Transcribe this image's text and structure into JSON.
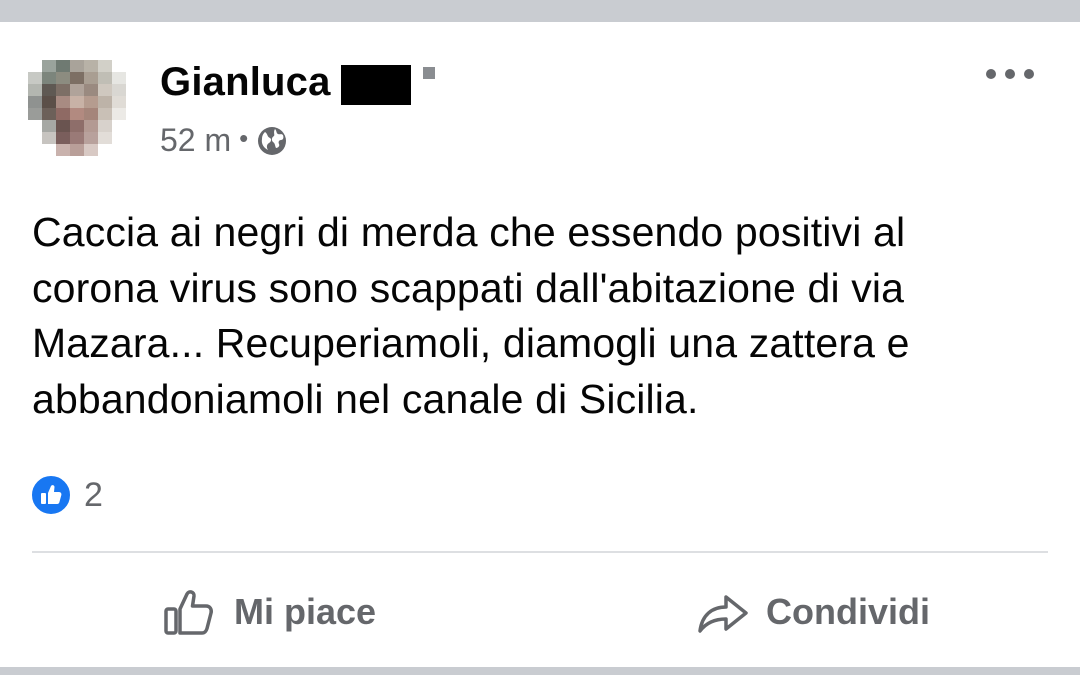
{
  "post": {
    "author_name": "Gianluca",
    "timestamp": "52 m",
    "separator": "•",
    "audience_icon": "globe-icon",
    "text": "Caccia ai negri di merda che essendo positivi al corona virus sono scappati dall'abitazione di via Mazara... Recuperiamoli, diamogli una zattera e abbandoniamoli nel canale di Sicilia.",
    "reactions": {
      "icon": "like-icon",
      "count": "2"
    }
  },
  "actions": {
    "like_label": "Mi piace",
    "share_label": "Condividi"
  },
  "colors": {
    "like_blue": "#1877f2",
    "secondary_text": "#65676b",
    "primary_text": "#050505",
    "background": "#c9ccd1"
  }
}
